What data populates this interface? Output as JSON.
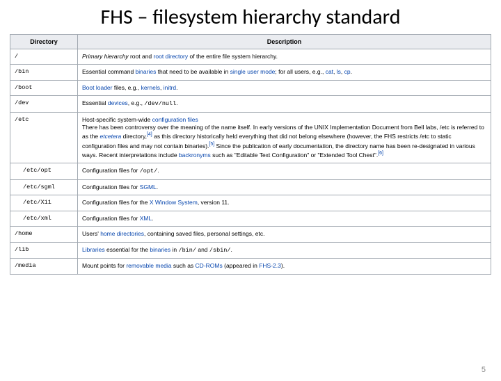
{
  "title": "FHS – filesystem hierarchy standard",
  "headers": {
    "dir": "Directory",
    "desc": "Description"
  },
  "rows": {
    "root": {
      "dir": "/",
      "d1": "Primary hierarchy",
      "d2": " root and ",
      "d3": "root directory",
      "d4": " of the entire file system hierarchy."
    },
    "bin": {
      "dir": "/bin",
      "d1": "Essential command ",
      "d2": "binaries",
      "d3": " that need to be available in ",
      "d4": "single user mode",
      "d5": "; for all users, e.g., ",
      "d6": "cat",
      "d7": ", ",
      "d8": "ls",
      "d9": ", ",
      "d10": "cp",
      "d11": "."
    },
    "boot": {
      "dir": "/boot",
      "d1": "Boot loader",
      "d2": " files, e.g., ",
      "d3": "kernels",
      "d4": ", ",
      "d5": "initrd",
      "d6": "."
    },
    "dev": {
      "dir": "/dev",
      "d1": "Essential ",
      "d2": "devices",
      "d3": ", e.g., ",
      "d4": "/dev/null",
      "d5": "."
    },
    "etc": {
      "dir": "/etc",
      "l1a": "Host-specific system-wide ",
      "l1b": "configuration files",
      "l2a": "There has been controversy over the meaning of the name itself. In early versions of the UNIX Implementation Document from Bell labs, /etc is referred to as the ",
      "l2b": "etcetera",
      "l2c": " directory,",
      "ref1": "[4]",
      "l2d": " as this directory historically held everything that did not belong elsewhere (however, the FHS restricts /etc to static configuration files and may not contain binaries).",
      "ref2": "[5]",
      "l2e": " Since the publication of early documentation, the directory name has been re-designated in various ways. Recent interpretations include ",
      "l2f": "backronyms",
      "l2g": " such as \"Editable Text Configuration\" or \"Extended Tool Chest\".",
      "ref3": "[6]"
    },
    "opt": {
      "dir": "/etc/opt",
      "d1": "Configuration files for ",
      "d2": "/opt/",
      "d3": "."
    },
    "sgml": {
      "dir": "/etc/sgml",
      "d1": "Configuration files for ",
      "d2": "SGML",
      "d3": "."
    },
    "x11": {
      "dir": "/etc/X11",
      "d1": "Configuration files for the ",
      "d2": "X Window System",
      "d3": ", version 11."
    },
    "xml": {
      "dir": "/etc/xml",
      "d1": "Configuration files for ",
      "d2": "XML",
      "d3": "."
    },
    "home": {
      "dir": "/home",
      "d1": "Users' ",
      "d2": "home directories",
      "d3": ", containing saved files, personal settings, etc."
    },
    "lib": {
      "dir": "/lib",
      "d1": "Libraries",
      "d2": " essential for the ",
      "d3": "binaries",
      "d4": " in ",
      "d5": "/bin/",
      "d6": " and ",
      "d7": "/sbin/",
      "d8": "."
    },
    "media": {
      "dir": "/media",
      "d1": "Mount points for ",
      "d2": "removable media",
      "d3": " such as ",
      "d4": "CD-ROMs",
      "d5": " (appeared in ",
      "d6": "FHS-2.3",
      "d7": ")."
    }
  },
  "pagenum": "5"
}
